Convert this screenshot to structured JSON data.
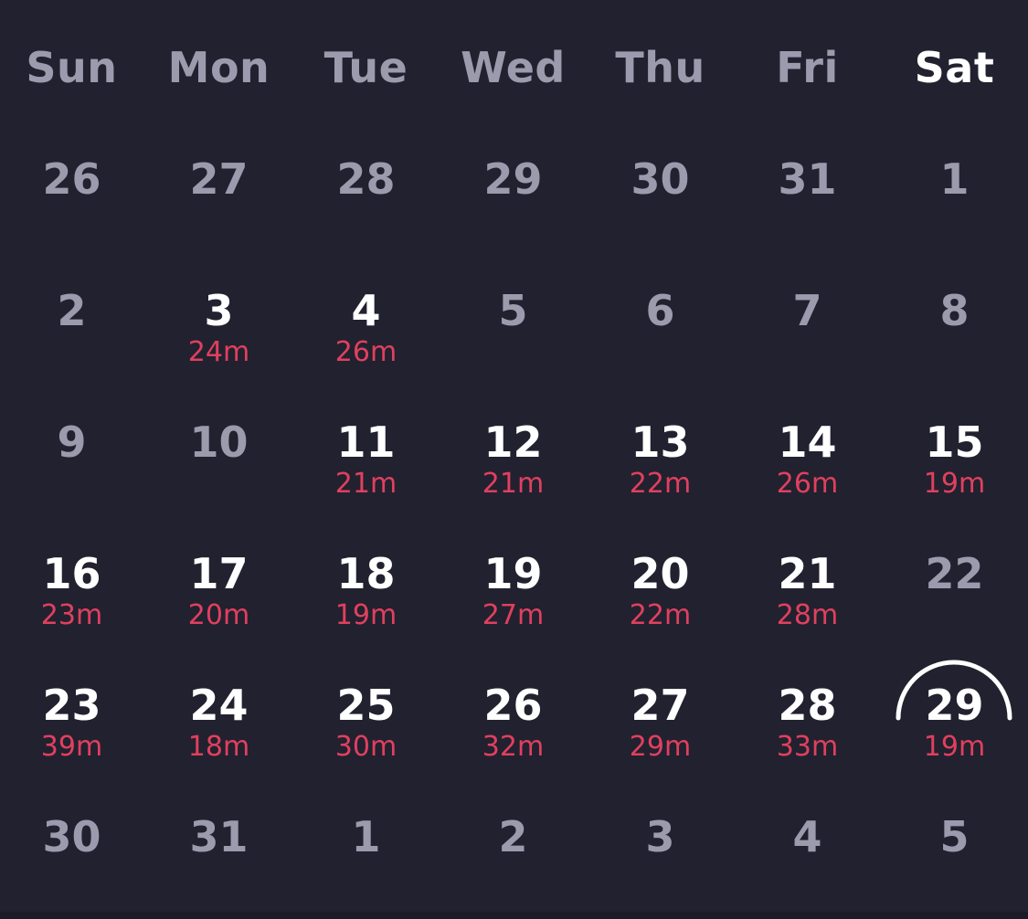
{
  "weekdays": [
    "Sun",
    "Mon",
    "Tue",
    "Wed",
    "Thu",
    "Fri",
    "Sat"
  ],
  "active_weekday_index": 6,
  "colors": {
    "background": "#22212f",
    "muted": "#9c9bad",
    "active": "#ffffff",
    "duration": "#e0405f"
  },
  "weeks": [
    [
      {
        "day": "26",
        "active": false,
        "duration": ""
      },
      {
        "day": "27",
        "active": false,
        "duration": ""
      },
      {
        "day": "28",
        "active": false,
        "duration": ""
      },
      {
        "day": "29",
        "active": false,
        "duration": ""
      },
      {
        "day": "30",
        "active": false,
        "duration": ""
      },
      {
        "day": "31",
        "active": false,
        "duration": ""
      },
      {
        "day": "1",
        "active": false,
        "duration": ""
      }
    ],
    [
      {
        "day": "2",
        "active": false,
        "duration": ""
      },
      {
        "day": "3",
        "active": true,
        "duration": "24m"
      },
      {
        "day": "4",
        "active": true,
        "duration": "26m"
      },
      {
        "day": "5",
        "active": false,
        "duration": ""
      },
      {
        "day": "6",
        "active": false,
        "duration": ""
      },
      {
        "day": "7",
        "active": false,
        "duration": ""
      },
      {
        "day": "8",
        "active": false,
        "duration": ""
      }
    ],
    [
      {
        "day": "9",
        "active": false,
        "duration": ""
      },
      {
        "day": "10",
        "active": false,
        "duration": ""
      },
      {
        "day": "11",
        "active": true,
        "duration": "21m"
      },
      {
        "day": "12",
        "active": true,
        "duration": "21m"
      },
      {
        "day": "13",
        "active": true,
        "duration": "22m"
      },
      {
        "day": "14",
        "active": true,
        "duration": "26m"
      },
      {
        "day": "15",
        "active": true,
        "duration": "19m"
      }
    ],
    [
      {
        "day": "16",
        "active": true,
        "duration": "23m"
      },
      {
        "day": "17",
        "active": true,
        "duration": "20m"
      },
      {
        "day": "18",
        "active": true,
        "duration": "19m"
      },
      {
        "day": "19",
        "active": true,
        "duration": "27m"
      },
      {
        "day": "20",
        "active": true,
        "duration": "22m"
      },
      {
        "day": "21",
        "active": true,
        "duration": "28m"
      },
      {
        "day": "22",
        "active": false,
        "duration": ""
      }
    ],
    [
      {
        "day": "23",
        "active": true,
        "duration": "39m"
      },
      {
        "day": "24",
        "active": true,
        "duration": "18m"
      },
      {
        "day": "25",
        "active": true,
        "duration": "30m"
      },
      {
        "day": "26",
        "active": true,
        "duration": "32m"
      },
      {
        "day": "27",
        "active": true,
        "duration": "29m"
      },
      {
        "day": "28",
        "active": true,
        "duration": "33m"
      },
      {
        "day": "29",
        "active": true,
        "duration": "19m",
        "today": true
      }
    ],
    [
      {
        "day": "30",
        "active": false,
        "duration": ""
      },
      {
        "day": "31",
        "active": false,
        "duration": ""
      },
      {
        "day": "1",
        "active": false,
        "duration": ""
      },
      {
        "day": "2",
        "active": false,
        "duration": ""
      },
      {
        "day": "3",
        "active": false,
        "duration": ""
      },
      {
        "day": "4",
        "active": false,
        "duration": ""
      },
      {
        "day": "5",
        "active": false,
        "duration": ""
      }
    ]
  ]
}
